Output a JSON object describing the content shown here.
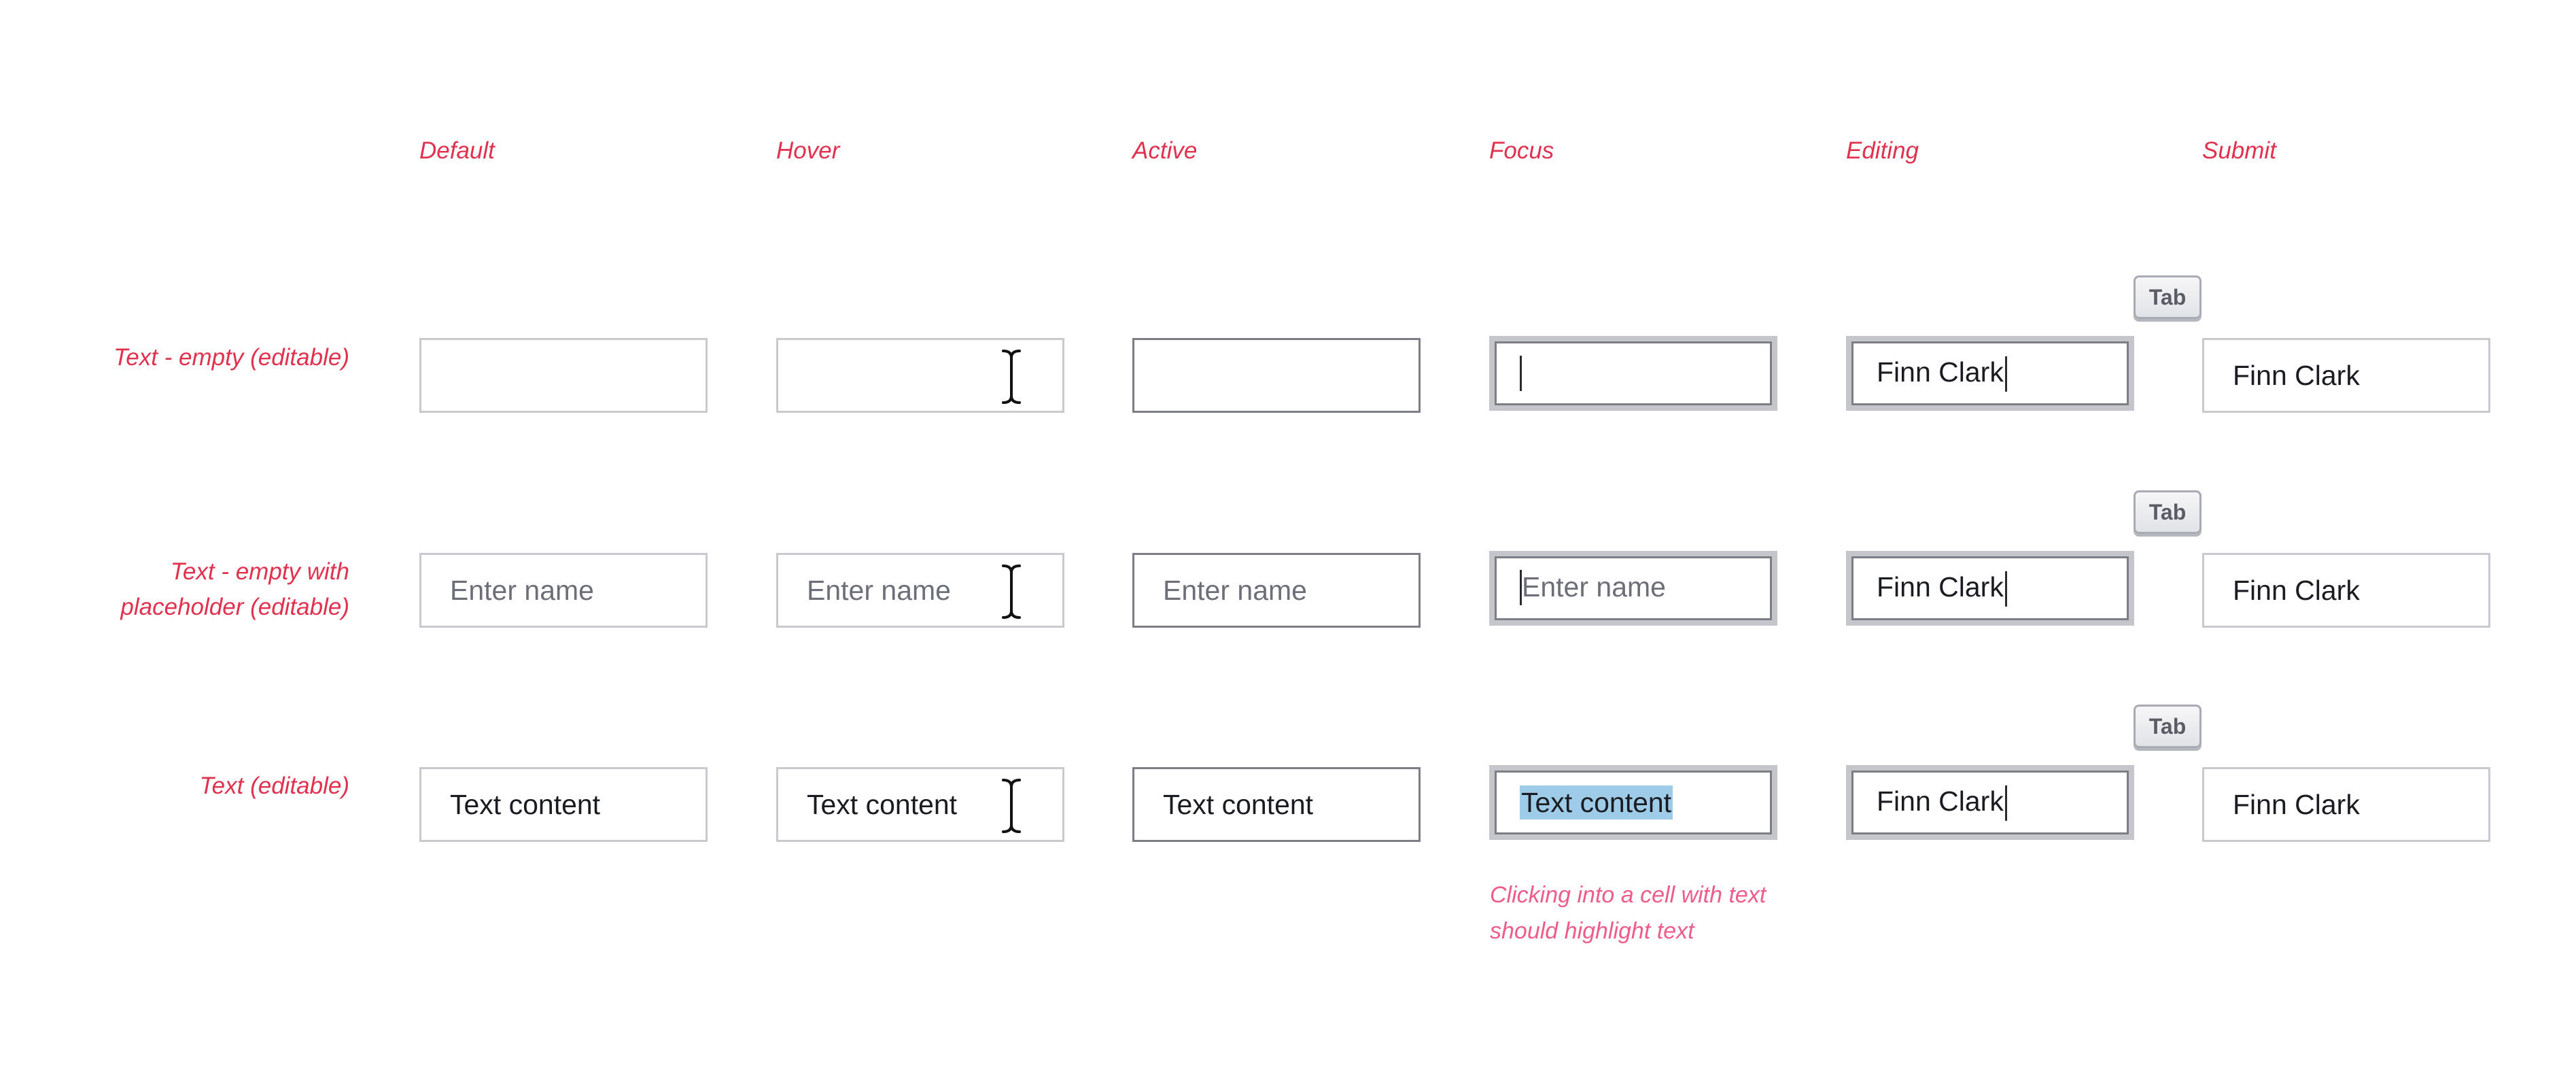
{
  "columns": [
    "Default",
    "Hover",
    "Active",
    "Focus",
    "Editing",
    "Submit"
  ],
  "rows": [
    {
      "label": "Text - empty (editable)",
      "cells": {
        "default": "",
        "hover": "",
        "active": "",
        "focus": "",
        "editing": "Finn Clark",
        "submit": "Finn Clark"
      }
    },
    {
      "label_line1": "Text - empty with",
      "label_line2": "placeholder (editable)",
      "placeholder": "Enter name",
      "cells": {
        "editing": "Finn Clark",
        "submit": "Finn Clark"
      }
    },
    {
      "label": "Text (editable)",
      "cells": {
        "default": "Text content",
        "hover": "Text content",
        "active": "Text content",
        "focus": "Text content",
        "editing": "Finn Clark",
        "submit": "Finn Clark"
      }
    }
  ],
  "tab_key": "Tab",
  "note": {
    "line1": "Clicking into a cell with text",
    "line2": "should highlight text"
  },
  "colors": {
    "label": "#e0314f",
    "note": "#ee5c8a",
    "highlight": "#9ecbe8",
    "border": "#c9c9cf",
    "border_dark": "#7c7e86"
  },
  "icons": {
    "hover_cursor": "ibeam-cursor-icon"
  }
}
